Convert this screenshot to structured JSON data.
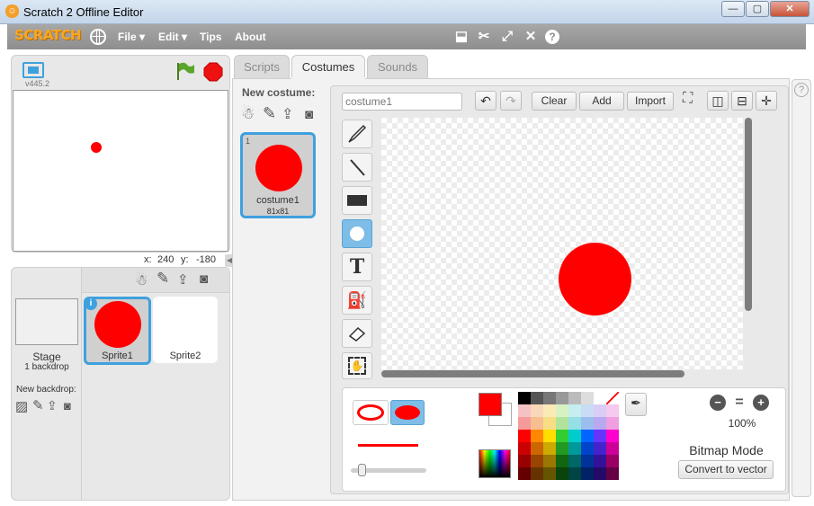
{
  "window": {
    "title": "Scratch 2 Offline Editor",
    "minimize": "—",
    "maximize": "▢",
    "close": "✕"
  },
  "menubar": {
    "logo": "SCRATCH",
    "items": [
      "File ▾",
      "Edit ▾",
      "Tips",
      "About"
    ],
    "tool_icons": [
      "duplicate-icon",
      "cut-icon",
      "grow-icon",
      "shrink-icon",
      "help-icon"
    ]
  },
  "stage": {
    "version": "v445.2",
    "x_label": "x:",
    "x_value": "240",
    "y_label": "y:",
    "y_value": "-180"
  },
  "sprites": {
    "stage_label": "Stage",
    "backdrop_count": "1 backdrop",
    "new_backdrop": "New backdrop:",
    "items": [
      {
        "name": "Sprite1"
      },
      {
        "name": "Sprite2"
      }
    ]
  },
  "tabs": [
    "Scripts",
    "Costumes",
    "Sounds"
  ],
  "costumes": {
    "new_costume": "New costume:",
    "items": [
      {
        "index": "1",
        "name": "costume1",
        "size": "81x81"
      }
    ]
  },
  "paint": {
    "costume_name": "costume1",
    "clear": "Clear",
    "add": "Add",
    "import": "Import",
    "zoom": "100%",
    "mode": "Bitmap Mode",
    "convert": "Convert to vector"
  },
  "colors": {
    "primary": "#ff0000",
    "secondary": "#ffffff",
    "accent": "#3fa0de"
  }
}
